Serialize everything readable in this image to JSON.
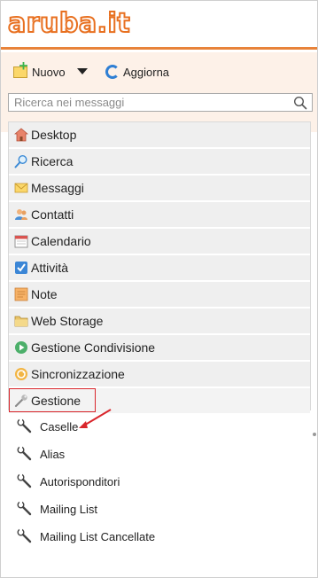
{
  "header": {
    "logo_text": "aruba.it",
    "accent_color": "#e8833a"
  },
  "toolbar": {
    "new_label": "Nuovo",
    "new_icon": "new-mail-icon",
    "dropdown_icon": "caret-down-icon",
    "refresh_label": "Aggiorna",
    "refresh_icon": "refresh-icon"
  },
  "search": {
    "placeholder": "Ricerca nei messaggi",
    "value": "",
    "icon": "search-icon"
  },
  "nav": {
    "items": [
      {
        "label": "Desktop",
        "icon": "home-icon"
      },
      {
        "label": "Ricerca",
        "icon": "magnifier-icon"
      },
      {
        "label": "Messaggi",
        "icon": "envelope-icon"
      },
      {
        "label": "Contatti",
        "icon": "contacts-icon"
      },
      {
        "label": "Calendario",
        "icon": "calendar-icon"
      },
      {
        "label": "Attività",
        "icon": "checkbox-icon"
      },
      {
        "label": "Note",
        "icon": "note-icon"
      },
      {
        "label": "Web Storage",
        "icon": "folder-icon"
      },
      {
        "label": "Gestione Condivisione",
        "icon": "share-icon"
      },
      {
        "label": "Sincronizzazione",
        "icon": "sync-icon"
      },
      {
        "label": "Gestione",
        "icon": "wrench-icon",
        "selected": true
      }
    ],
    "subitems": [
      {
        "label": "Caselle",
        "icon": "wrench-icon"
      },
      {
        "label": "Alias",
        "icon": "wrench-icon"
      },
      {
        "label": "Autorisponditori",
        "icon": "wrench-icon"
      },
      {
        "label": "Mailing List",
        "icon": "wrench-icon"
      },
      {
        "label": "Mailing List Cancellate",
        "icon": "wrench-icon"
      }
    ]
  },
  "annotation": {
    "highlight_color": "#d9262c"
  }
}
